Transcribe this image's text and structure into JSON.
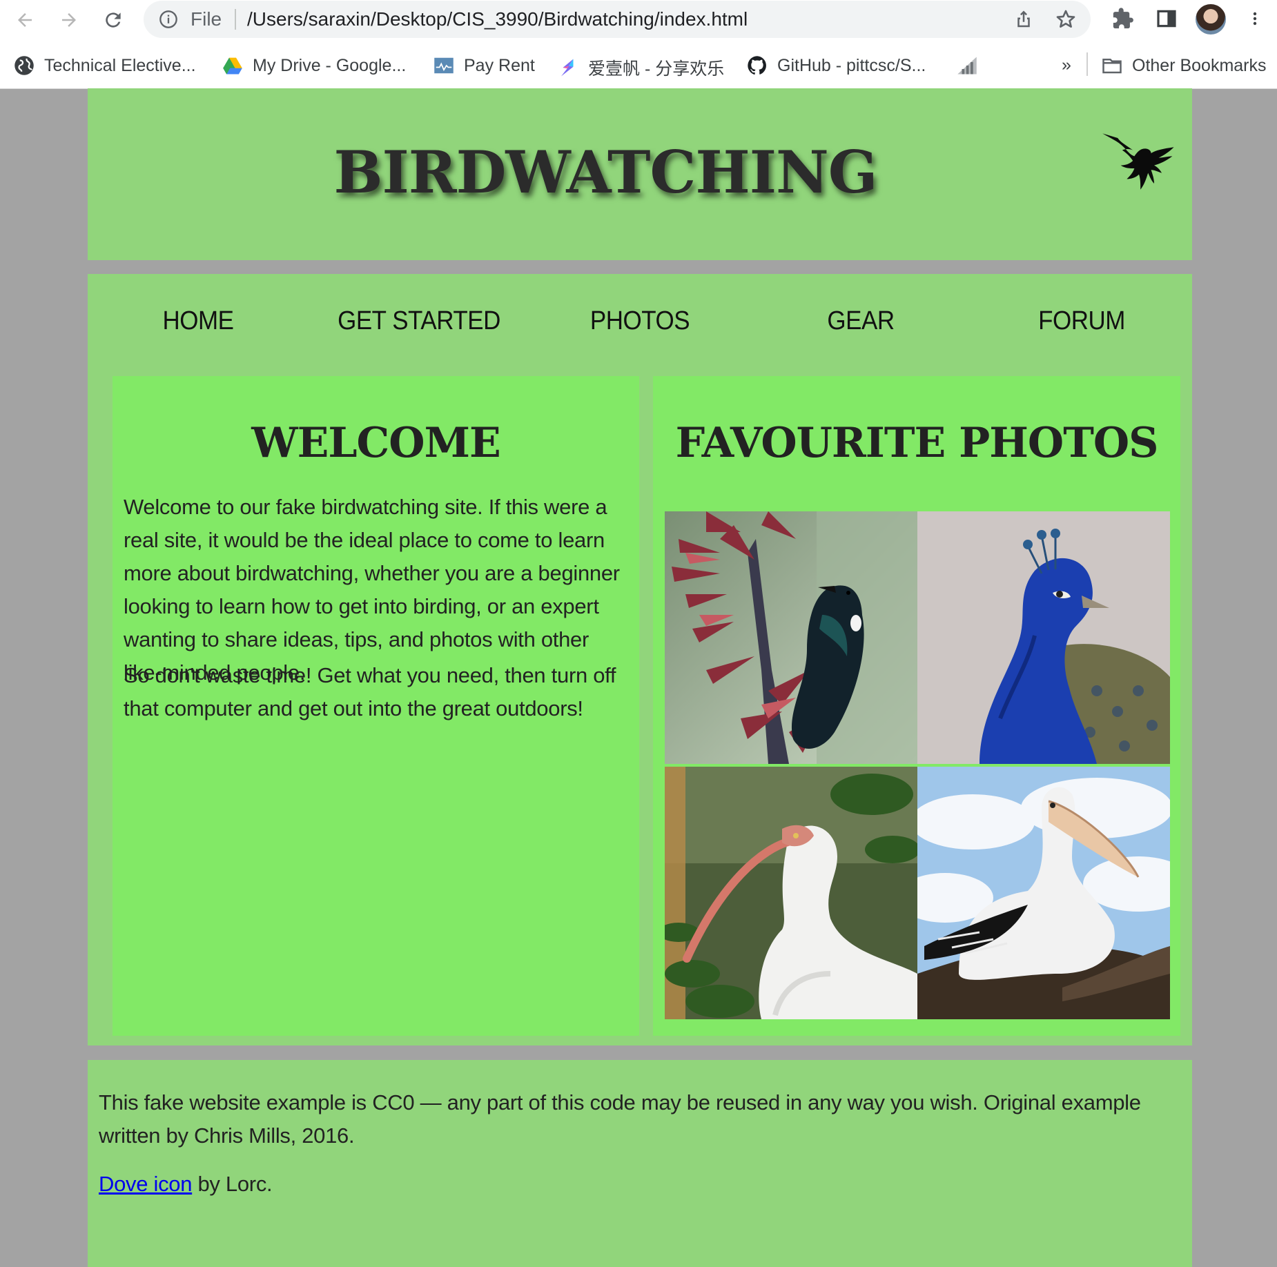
{
  "browser": {
    "omnibox": {
      "scheme_label": "File",
      "url": "/Users/saraxin/Desktop/CIS_3990/Birdwatching/index.html"
    },
    "bookmarks": [
      {
        "label": "Technical Elective...",
        "icon": "globe-icon"
      },
      {
        "label": "My Drive - Google...",
        "icon": "google-drive-icon"
      },
      {
        "label": "Pay Rent",
        "icon": "pay-rent-icon"
      },
      {
        "label": "爱壹帆 - 分享欢乐",
        "icon": "aiyifan-icon"
      },
      {
        "label": "GitHub - pittcsc/S...",
        "icon": "github-icon"
      },
      {
        "label": "",
        "icon": "chart-bookmark-icon"
      }
    ],
    "overflow_label": "»",
    "other_bookmarks_label": "Other Bookmarks"
  },
  "site": {
    "title": "BIRDWATCHING",
    "logo_icon": "dove-icon",
    "nav": [
      "HOME",
      "GET STARTED",
      "PHOTOS",
      "GEAR",
      "FORUM"
    ],
    "welcome": {
      "heading": "WELCOME",
      "paragraphs": [
        "Welcome to our fake birdwatching site. If this were a real site, it would be the ideal place to come to learn more about birdwatching, whether you are a beginner looking to learn how to get into birding, or an expert wanting to share ideas, tips, and photos with other like-minded people.",
        "So don't waste time! Get what you need, then turn off that computer and get out into the great outdoors!"
      ]
    },
    "photos": {
      "heading": "FAVOURITE PHOTOS",
      "items": [
        "tui-photo",
        "peacock-photo",
        "ibis-photo",
        "pelican-photo"
      ]
    },
    "footer": {
      "license_text": "This fake website example is CC0 — any part of this code may be reused in any way you wish. Original example written by Chris Mills, 2016.",
      "credit_link": "Dove icon",
      "credit_suffix": " by Lorc."
    }
  }
}
